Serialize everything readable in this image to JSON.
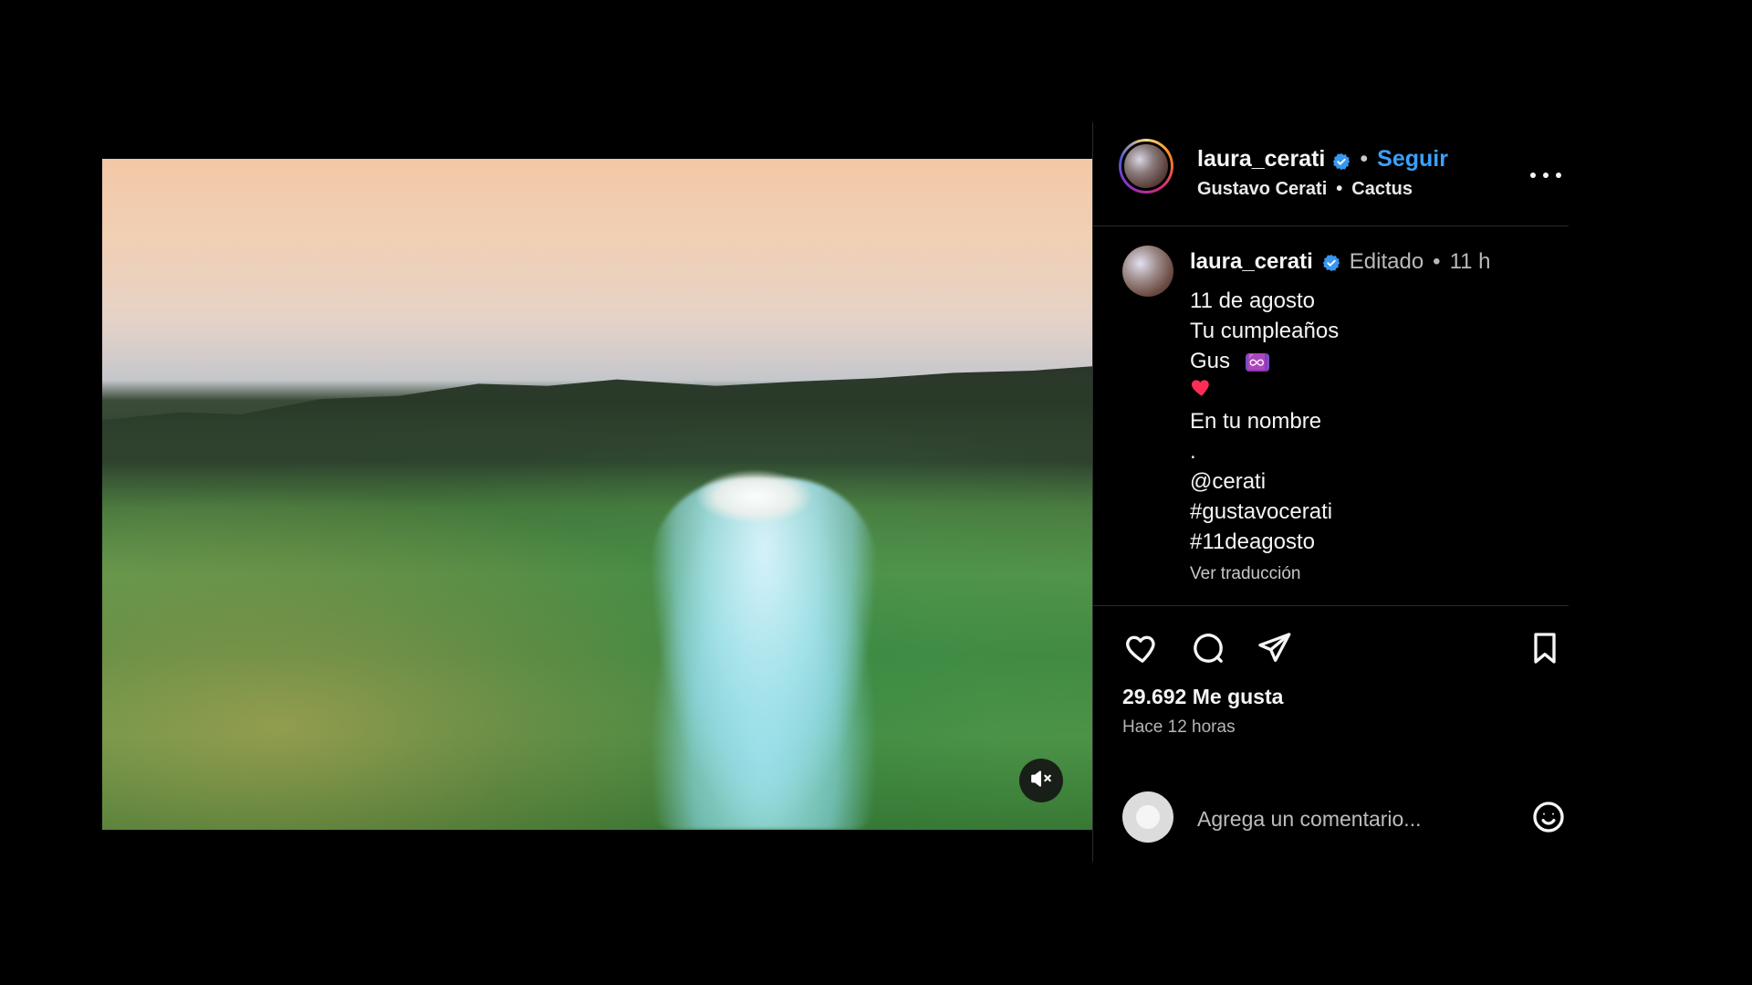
{
  "post": {
    "username": "laura_cerati",
    "follow_label": "Seguir",
    "dot": "•",
    "music": {
      "artist": "Gustavo Cerati",
      "song": "Cactus"
    },
    "more_icon": "more-horizontal-icon",
    "mute_icon": "speaker-muted-icon"
  },
  "caption": {
    "username": "laura_cerati",
    "edited": "Editado",
    "dot": "•",
    "time": "11 h",
    "lines": [
      "11 de agosto",
      "Tu cumpleaños",
      "Gus",
      "",
      "En tu nombre",
      ".",
      "@cerati",
      "#gustavocerati",
      "#11deagosto"
    ],
    "infinity_emoji": "♾️",
    "heart_emoji": "heart-emoji-red",
    "translate_label": "Ver traducción"
  },
  "actions": {
    "like_icon": "heart-outline-icon",
    "comment_icon": "comment-bubble-icon",
    "share_icon": "send-paper-plane-icon",
    "save_icon": "bookmark-outline-icon"
  },
  "stats": {
    "likes_text": "29.692 Me gusta",
    "time_ago": "Hace 12 horas"
  },
  "comment_box": {
    "placeholder": "Agrega un comentario...",
    "emoji_icon": "smiley-icon"
  },
  "colors": {
    "background": "#000000",
    "text": "#f5f5f5",
    "accent_link": "#3aa0ff",
    "muted": "#b9b9b9",
    "divider": "#2a2a2a",
    "verified": "#3897f0",
    "heart_red": "#ff2d55"
  }
}
